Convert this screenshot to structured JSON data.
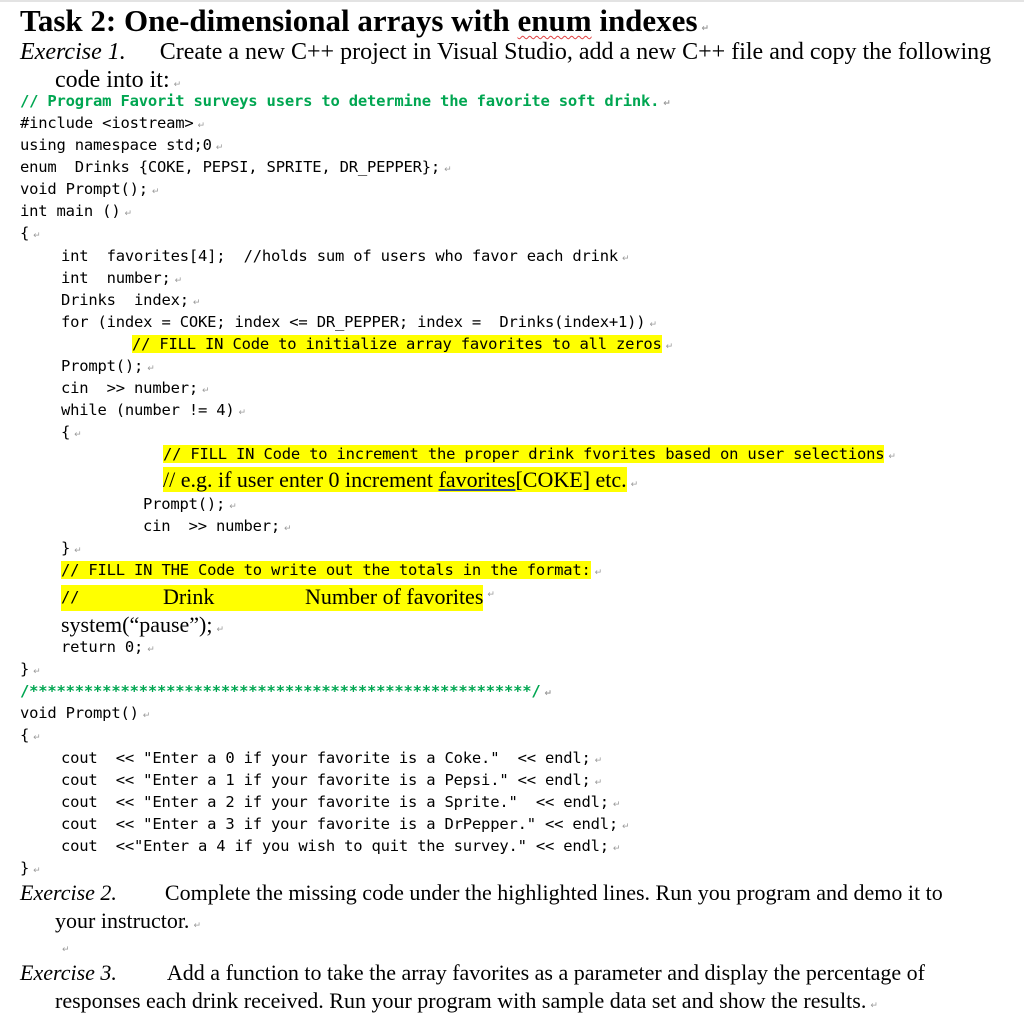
{
  "document": {
    "title": {
      "pre": "Task 2: One-dimensional arrays with ",
      "squiggle": "enum",
      "post": " indexes"
    },
    "exercise1": {
      "label": "Exercise 1.",
      "text_line1": "Create a new C++ project in Visual Studio, add a new C++ file and copy the following",
      "text_line2": "code into it:"
    },
    "code_main": [
      {
        "text": "// Program Favorit surveys users to determine the favorite soft drink.",
        "style": "comment"
      },
      {
        "text": "#include <iostream>"
      },
      {
        "text": "using namespace std;0"
      },
      {
        "text": "enum  Drinks {COKE, PEPSI, SPRITE, DR_PEPPER};"
      },
      {
        "text": "void Prompt();"
      },
      {
        "text": "int main ()"
      },
      {
        "text": "{"
      },
      {
        "text": "int  favorites[4];  //holds sum of users who favor each drink"
      },
      {
        "text": "int  number;"
      },
      {
        "text": "Drinks  index;"
      },
      {
        "text": "for (index = COKE; index <= DR_PEPPER; index =  Drinks(index+1))"
      },
      {
        "text": "// FILL IN Code to initialize array favorites to all zeros",
        "style": "highlight"
      },
      {
        "text": "Prompt();"
      },
      {
        "text": "cin  >> number;"
      },
      {
        "text": "while (number != 4)"
      },
      {
        "text": "{"
      },
      {
        "text": "// FILL IN Code to increment the proper drink fvorites based on user selections",
        "style": "highlight"
      },
      {
        "text_pre": "// e.g. if user enter 0 increment ",
        "text_under": "favorites",
        "text_post": "[COKE] etc.",
        "style": "highlight-serif"
      },
      {
        "text": "Prompt();"
      },
      {
        "text": "cin  >> number;"
      },
      {
        "text": "}"
      },
      {
        "text": "// FILL IN THE Code to write out the totals in the format:",
        "style": "highlight"
      },
      {
        "c1": "//",
        "c2": "Drink",
        "c3": "Number of favorites",
        "style": "highlight-serif"
      },
      {
        "text": "system(“pause”);",
        "style": "serif"
      },
      {
        "text": "return 0;"
      },
      {
        "text": "}"
      },
      {
        "text": "/*******************************************************/",
        "style": "comment"
      },
      {
        "text": "void Prompt()"
      },
      {
        "text": "{"
      },
      {
        "text": "cout  << \"Enter a 0 if your favorite is a Coke.\"  << endl;"
      },
      {
        "text": "cout  << \"Enter a 1 if your favorite is a Pepsi.\" << endl;"
      },
      {
        "text": "cout  << \"Enter a 2 if your favorite is a Sprite.\"  << endl;"
      },
      {
        "text": "cout  << \"Enter a 3 if your favorite is a DrPepper.\" << endl;"
      },
      {
        "text": "cout  <<\"Enter a 4 if you wish to quit the survey.\" << endl;"
      },
      {
        "text": "}"
      }
    ],
    "exercise2": {
      "label": "Exercise 2.",
      "text_line1": "Complete the missing code under the highlighted lines. Run you program and demo it to",
      "text_line2": "your instructor."
    },
    "exercise3": {
      "label": "Exercise 3.",
      "text_line1": "Add a function to take the array favorites as a parameter and display the percentage of",
      "text_line2": "responses each drink received. Run your program with sample data set and show the results."
    },
    "paragraph_mark": "↵"
  }
}
